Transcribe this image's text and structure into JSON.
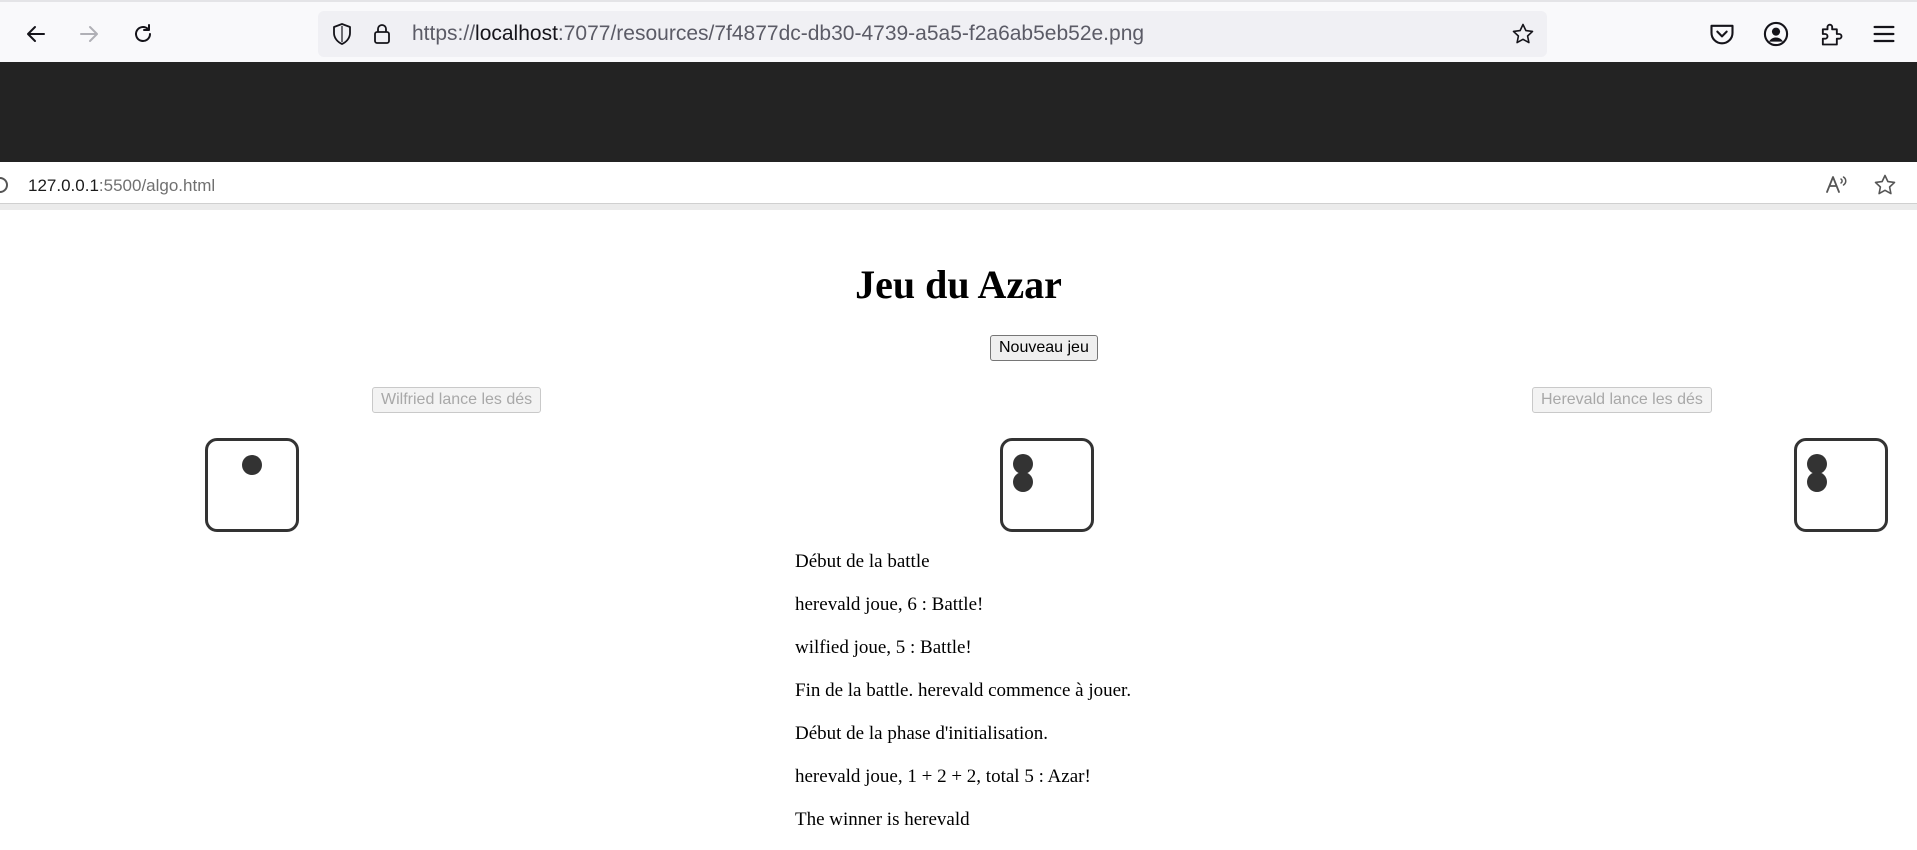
{
  "browser": {
    "url_prefix": "https://",
    "url_host": "localhost",
    "url_rest": ":7077/resources/7f4877dc-db30-4739-a5a5-f2a6ab5eb52e.png"
  },
  "inner_browser": {
    "url_host": "127.0.0.1",
    "url_rest": ":5500/algo.html"
  },
  "page": {
    "title": "Jeu du Azar",
    "new_game_label": "Nouveau jeu",
    "player1_button": "Wilfried lance les dés",
    "player2_button": "Herevald lance les dés"
  },
  "dice": [
    {
      "value": 1
    },
    {
      "value": 2
    },
    {
      "value": 2
    }
  ],
  "log": [
    "Début de la battle",
    "herevald joue, 6 : Battle!",
    "wilfied joue, 5 : Battle!",
    "Fin de la battle. herevald commence à jouer.",
    "Début de la phase d'initialisation.",
    "herevald joue, 1 + 2 + 2, total 5 : Azar!",
    "The winner is herevald"
  ]
}
